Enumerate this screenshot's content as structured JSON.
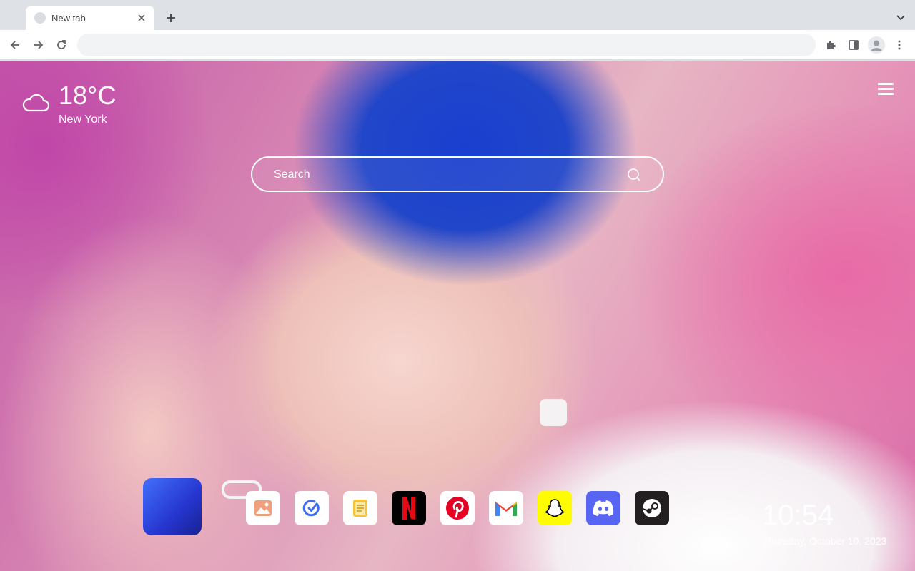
{
  "browser": {
    "tab_title": "New tab",
    "omnibox_value": ""
  },
  "weather": {
    "temperature": "18°C",
    "city": "New York",
    "icon": "cloud-icon"
  },
  "search": {
    "placeholder": "Search"
  },
  "shortcuts": [
    {
      "name": "Wallpapers",
      "icon": "image-icon",
      "bg": "#ffffff"
    },
    {
      "name": "Tasks",
      "icon": "check-circle-icon",
      "bg": "#ffffff"
    },
    {
      "name": "Notes",
      "icon": "notes-icon",
      "bg": "#ffffff"
    },
    {
      "name": "Netflix",
      "icon": "netflix-icon",
      "bg": "#000000"
    },
    {
      "name": "Pinterest",
      "icon": "pinterest-icon",
      "bg": "#ffffff"
    },
    {
      "name": "Gmail",
      "icon": "gmail-icon",
      "bg": "#ffffff"
    },
    {
      "name": "Snapchat",
      "icon": "snapchat-icon",
      "bg": "#fffc00"
    },
    {
      "name": "Discord",
      "icon": "discord-icon",
      "bg": "#5865f2"
    },
    {
      "name": "Steam",
      "icon": "steam-icon",
      "bg": "#231f20"
    }
  ],
  "clock": {
    "time": "10:54",
    "date": "Thursday, October 10, 2023"
  },
  "colors": {
    "netflix_red": "#e50914",
    "pinterest_red": "#e60023",
    "tasks_blue": "#3d6df2",
    "notes_yellow": "#f3c43a"
  }
}
